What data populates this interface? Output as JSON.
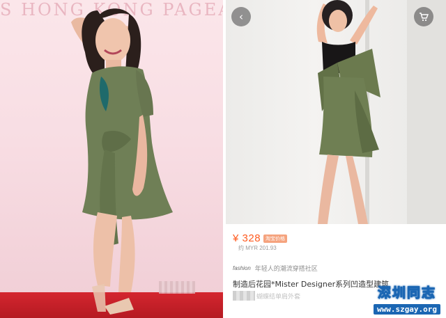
{
  "left_photo": {
    "backdrop_text": "S HONG KONG PAGEANT"
  },
  "right_panel": {
    "nav": {
      "back_icon": "chevron-left-icon",
      "cart_icon": "cart-icon"
    },
    "listing": {
      "price": "¥ 328",
      "price_tag": "淘宝价格",
      "converted_price": "约 MYR 201.93",
      "shop_name": "fashion",
      "shop_description": "年轻人的潮流穿搭社区",
      "title": "制造后花园*Mister Designer系列凹造型建筑",
      "subtitle": "蝴蝶结单肩外套"
    },
    "colors": {
      "price": "#ff5a1f",
      "dress": "#6f7f56"
    }
  },
  "watermark": {
    "title": "深圳同志",
    "url": "www.szgay.org",
    "color": "#1b66b3"
  }
}
